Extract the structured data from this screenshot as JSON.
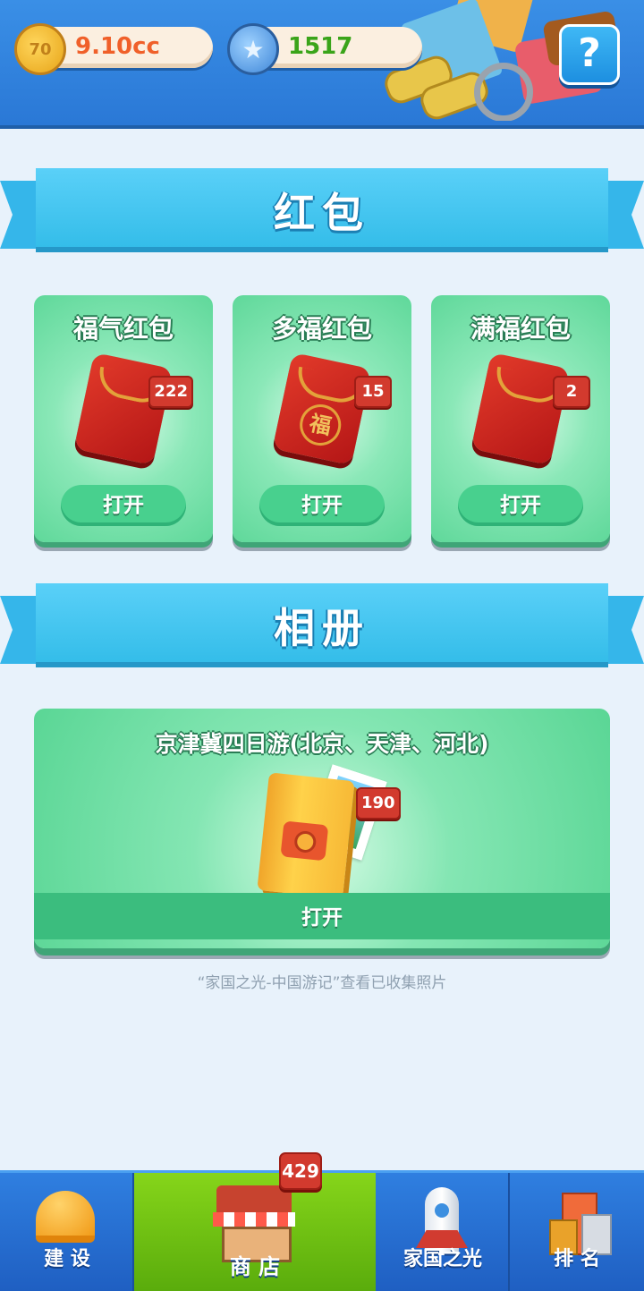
{
  "header": {
    "coin_value": "9.10cc",
    "coin_icon": "70",
    "star_value": "1517",
    "help_label": "?"
  },
  "red_packets": {
    "section_title": "红包",
    "items": [
      {
        "name": "福气红包",
        "count": "222",
        "button": "打开",
        "glyph": ""
      },
      {
        "name": "多福红包",
        "count": "15",
        "button": "打开",
        "glyph": "福"
      },
      {
        "name": "满福红包",
        "count": "2",
        "button": "打开",
        "glyph": ""
      }
    ]
  },
  "album": {
    "section_title": "相册",
    "title": "京津冀四日游(北京、天津、河北)",
    "count": "190",
    "button": "打开",
    "note": "“家国之光-中国游记”查看已收集照片"
  },
  "nav": {
    "items": [
      {
        "label": "建 设"
      },
      {
        "label": "商 店"
      },
      {
        "label": "家国之光"
      },
      {
        "label": "排 名"
      }
    ],
    "shop_badge": "429"
  },
  "colors": {
    "accent_green": "#48d08e",
    "badge_red": "#d23a2e",
    "header_blue": "#3a8fe6",
    "nav_active": "#86d51a"
  }
}
